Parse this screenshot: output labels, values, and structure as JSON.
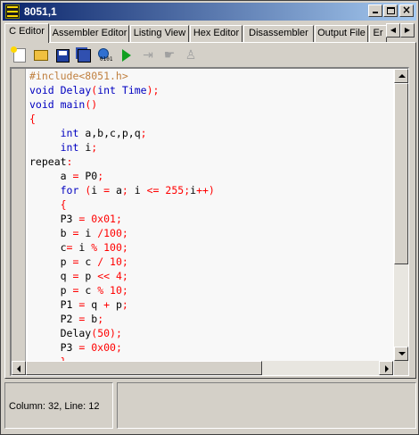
{
  "window": {
    "title": "8051,1"
  },
  "tabs": [
    {
      "label": "C Editor",
      "active": true
    },
    {
      "label": "Assembler Editor",
      "active": false
    },
    {
      "label": "Listing View",
      "active": false
    },
    {
      "label": "Hex Editor",
      "active": false
    },
    {
      "label": "Disassembler",
      "active": false
    },
    {
      "label": "Output File",
      "active": false
    },
    {
      "label": "Er",
      "active": false
    }
  ],
  "toolbar": {
    "items": [
      "new-file-icon",
      "open-file-icon",
      "save-icon",
      "save-all-icon",
      "compile-icon",
      "run-icon",
      "step-over-icon",
      "step-into-icon",
      "step-out-icon"
    ]
  },
  "editor": {
    "lines": [
      [
        {
          "t": "#include<8051.h>",
          "c": "c"
        }
      ],
      [
        {
          "t": "void ",
          "c": "k"
        },
        {
          "t": "Delay",
          "c": "k"
        },
        {
          "t": "(",
          "c": "p"
        },
        {
          "t": "int ",
          "c": "k"
        },
        {
          "t": "Time",
          "c": "k"
        },
        {
          "t": ");",
          "c": "p"
        }
      ],
      [
        {
          "t": "void ",
          "c": "k"
        },
        {
          "t": "main",
          "c": "k"
        },
        {
          "t": "()",
          "c": "p"
        }
      ],
      [
        {
          "t": "{",
          "c": "p"
        }
      ],
      [
        {
          "t": "     int ",
          "c": "k"
        },
        {
          "t": "a,b,c,p,q",
          "c": "d"
        },
        {
          "t": ";",
          "c": "p"
        }
      ],
      [
        {
          "t": "     int ",
          "c": "k"
        },
        {
          "t": "i",
          "c": "d"
        },
        {
          "t": ";",
          "c": "p"
        }
      ],
      [
        {
          "t": "repeat",
          "c": "d"
        },
        {
          "t": ":",
          "c": "p"
        }
      ],
      [
        {
          "t": "     a ",
          "c": "d"
        },
        {
          "t": "= ",
          "c": "p"
        },
        {
          "t": "P0",
          "c": "d"
        },
        {
          "t": ";",
          "c": "p"
        }
      ],
      [
        {
          "t": "     for ",
          "c": "k"
        },
        {
          "t": "(",
          "c": "p"
        },
        {
          "t": "i ",
          "c": "d"
        },
        {
          "t": "= ",
          "c": "p"
        },
        {
          "t": "a",
          "c": "d"
        },
        {
          "t": "; ",
          "c": "p"
        },
        {
          "t": "i ",
          "c": "d"
        },
        {
          "t": "<= ",
          "c": "p"
        },
        {
          "t": "255",
          "c": "n"
        },
        {
          "t": ";",
          "c": "p"
        },
        {
          "t": "i",
          "c": "d"
        },
        {
          "t": "++)",
          "c": "p"
        }
      ],
      [
        {
          "t": "     {",
          "c": "p"
        }
      ],
      [
        {
          "t": "     P3 ",
          "c": "d"
        },
        {
          "t": "= ",
          "c": "p"
        },
        {
          "t": "0x01",
          "c": "n"
        },
        {
          "t": ";",
          "c": "p"
        }
      ],
      [
        {
          "t": "     b ",
          "c": "d"
        },
        {
          "t": "= ",
          "c": "p"
        },
        {
          "t": "i ",
          "c": "d"
        },
        {
          "t": "/",
          "c": "p"
        },
        {
          "t": "100",
          "c": "n"
        },
        {
          "t": ";",
          "c": "p"
        }
      ],
      [
        {
          "t": "     c",
          "c": "d"
        },
        {
          "t": "= ",
          "c": "p"
        },
        {
          "t": "i ",
          "c": "d"
        },
        {
          "t": "% ",
          "c": "p"
        },
        {
          "t": "100",
          "c": "n"
        },
        {
          "t": ";",
          "c": "p"
        }
      ],
      [
        {
          "t": "     p ",
          "c": "d"
        },
        {
          "t": "= ",
          "c": "p"
        },
        {
          "t": "c ",
          "c": "d"
        },
        {
          "t": "/ ",
          "c": "p"
        },
        {
          "t": "10",
          "c": "n"
        },
        {
          "t": ";",
          "c": "p"
        }
      ],
      [
        {
          "t": "     q ",
          "c": "d"
        },
        {
          "t": "= ",
          "c": "p"
        },
        {
          "t": "p ",
          "c": "d"
        },
        {
          "t": "<< ",
          "c": "p"
        },
        {
          "t": "4",
          "c": "n"
        },
        {
          "t": ";",
          "c": "p"
        }
      ],
      [
        {
          "t": "     p ",
          "c": "d"
        },
        {
          "t": "= ",
          "c": "p"
        },
        {
          "t": "c ",
          "c": "d"
        },
        {
          "t": "% ",
          "c": "p"
        },
        {
          "t": "10",
          "c": "n"
        },
        {
          "t": ";",
          "c": "p"
        }
      ],
      [
        {
          "t": "     P1 ",
          "c": "d"
        },
        {
          "t": "= ",
          "c": "p"
        },
        {
          "t": "q ",
          "c": "d"
        },
        {
          "t": "+ ",
          "c": "p"
        },
        {
          "t": "p",
          "c": "d"
        },
        {
          "t": ";",
          "c": "p"
        }
      ],
      [
        {
          "t": "     P2 ",
          "c": "d"
        },
        {
          "t": "= ",
          "c": "p"
        },
        {
          "t": "b",
          "c": "d"
        },
        {
          "t": ";",
          "c": "p"
        }
      ],
      [
        {
          "t": "     Delay",
          "c": "d"
        },
        {
          "t": "(",
          "c": "p"
        },
        {
          "t": "50",
          "c": "n"
        },
        {
          "t": ");",
          "c": "p"
        }
      ],
      [
        {
          "t": "     P3 ",
          "c": "d"
        },
        {
          "t": "= ",
          "c": "p"
        },
        {
          "t": "0x00",
          "c": "n"
        },
        {
          "t": ";",
          "c": "p"
        }
      ],
      [
        {
          "t": "     }",
          "c": "p"
        }
      ]
    ]
  },
  "status": {
    "position": "Column: 32, Line: 12",
    "message": ""
  }
}
